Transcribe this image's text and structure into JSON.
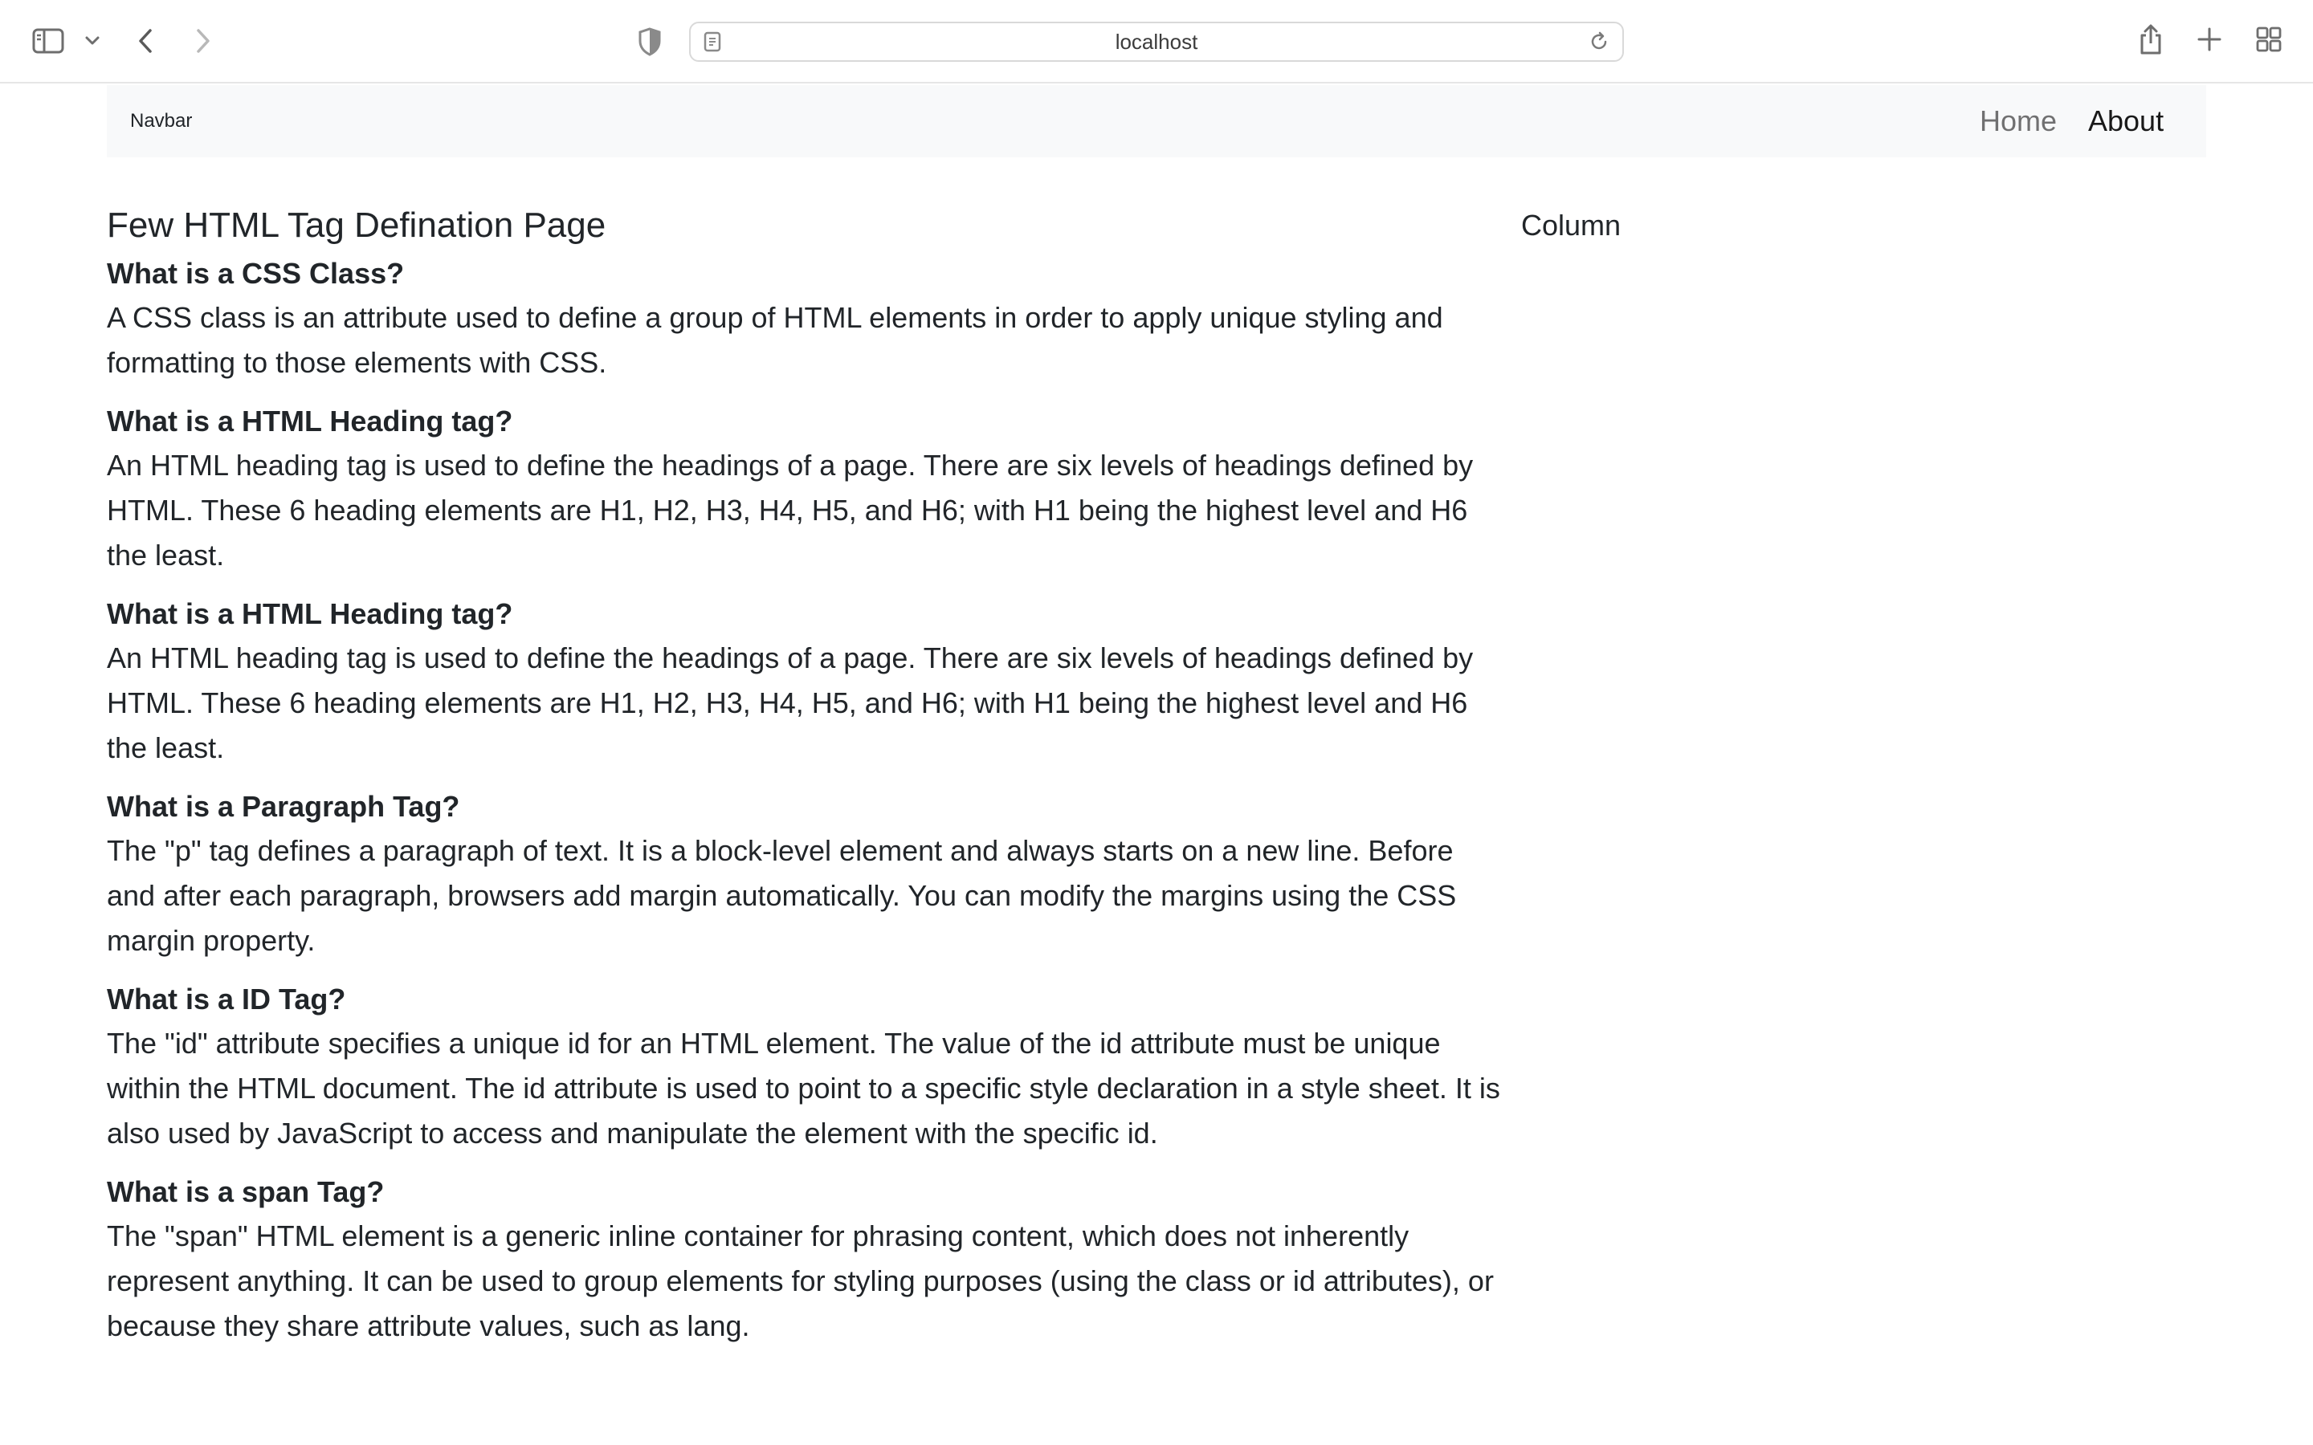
{
  "browser": {
    "url": "localhost",
    "icons": [
      "sidebar-icon",
      "chevron-down-icon",
      "back-icon",
      "forward-icon",
      "shield-icon",
      "page-icon",
      "reload-icon",
      "share-icon",
      "new-tab-icon",
      "tab-overview-icon"
    ]
  },
  "navbar": {
    "brand": "Navbar",
    "links": [
      "Home",
      "About"
    ]
  },
  "main": {
    "title": "Few HTML Tag Defination Page",
    "sections": [
      {
        "heading": "What is a CSS Class?",
        "text": "A CSS class is an attribute used to define a group of HTML elements in order to apply unique styling and formatting to those elements with CSS."
      },
      {
        "heading": "What is a HTML Heading tag?",
        "text": "An HTML heading tag is used to define the headings of a page. There are six levels of headings defined by HTML. These 6 heading elements are H1, H2, H3, H4, H5, and H6; with H1 being the highest level and H6 the least."
      },
      {
        "heading": "What is a HTML Heading tag?",
        "text": "An HTML heading tag is used to define the headings of a page. There are six levels of headings defined by HTML. These 6 heading elements are H1, H2, H3, H4, H5, and H6; with H1 being the highest level and H6 the least."
      },
      {
        "heading": "What is a Paragraph Tag?",
        "text": "The \"p\" tag defines a paragraph of text. It is a block-level element and always starts on a new line. Before and after each paragraph, browsers add margin automatically. You can modify the margins using the CSS margin property."
      },
      {
        "heading": "What is a ID Tag?",
        "text": "The \"id\" attribute specifies a unique id for an HTML element. The value of the id attribute must be unique within the HTML document. The id attribute is used to point to a specific style declaration in a style sheet. It is also used by JavaScript to access and manipulate the element with the specific id."
      },
      {
        "heading": "What is a span Tag?",
        "text": "The \"span\" HTML element is a generic inline container for phrasing content, which does not inherently represent anything. It can be used to group elements for styling purposes (using the class or id attributes), or because they share attribute values, such as lang."
      }
    ]
  },
  "aside": {
    "label": "Column"
  }
}
